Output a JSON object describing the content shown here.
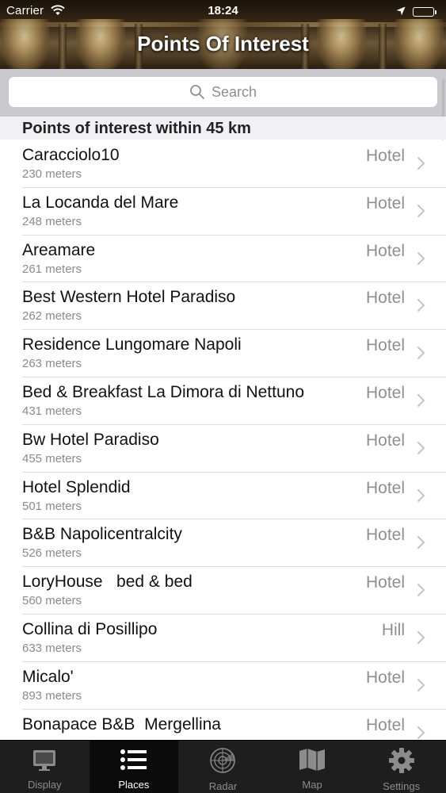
{
  "status_bar": {
    "carrier": "Carrier",
    "time": "18:24"
  },
  "nav": {
    "title": "Points Of Interest"
  },
  "search": {
    "placeholder": "Search"
  },
  "section": {
    "title": "Points of interest within 45 km"
  },
  "places": [
    {
      "name": "Caracciolo10",
      "distance": "230 meters",
      "category": "Hotel"
    },
    {
      "name": "La Locanda del Mare",
      "distance": "248 meters",
      "category": "Hotel"
    },
    {
      "name": "Areamare",
      "distance": "261 meters",
      "category": "Hotel"
    },
    {
      "name": "Best Western Hotel Paradiso",
      "distance": "262 meters",
      "category": "Hotel"
    },
    {
      "name": "Residence Lungomare Napoli",
      "distance": "263 meters",
      "category": "Hotel"
    },
    {
      "name": "Bed & Breakfast La Dimora di Nettuno",
      "distance": "431 meters",
      "category": "Hotel"
    },
    {
      "name": "Bw Hotel Paradiso",
      "distance": "455 meters",
      "category": "Hotel"
    },
    {
      "name": "Hotel Splendid",
      "distance": "501 meters",
      "category": "Hotel"
    },
    {
      "name": "B&B Napolicentralcity",
      "distance": "526 meters",
      "category": "Hotel"
    },
    {
      "name": "LoryHouse   bed & bed",
      "distance": "560 meters",
      "category": "Hotel"
    },
    {
      "name": "Collina di Posillipo",
      "distance": "633 meters",
      "category": "Hill"
    },
    {
      "name": "Micalo'",
      "distance": "893 meters",
      "category": "Hotel"
    },
    {
      "name": "Bonapace B&B  Mergellina",
      "distance": "",
      "category": "Hotel"
    }
  ],
  "tabs": [
    {
      "label": "Display",
      "icon": "monitor-icon",
      "active": false
    },
    {
      "label": "Places",
      "icon": "list-icon",
      "active": true
    },
    {
      "label": "Radar",
      "icon": "radar-icon",
      "active": false
    },
    {
      "label": "Map",
      "icon": "map-icon",
      "active": false
    },
    {
      "label": "Settings",
      "icon": "gear-icon",
      "active": false
    }
  ],
  "colors": {
    "tab_bar": "#1e1e1e",
    "tab_active": "#0b0b0b",
    "search_bar": "#c9c9ce",
    "section_header": "#f1f1f3",
    "secondary_text": "#8e8e93"
  }
}
